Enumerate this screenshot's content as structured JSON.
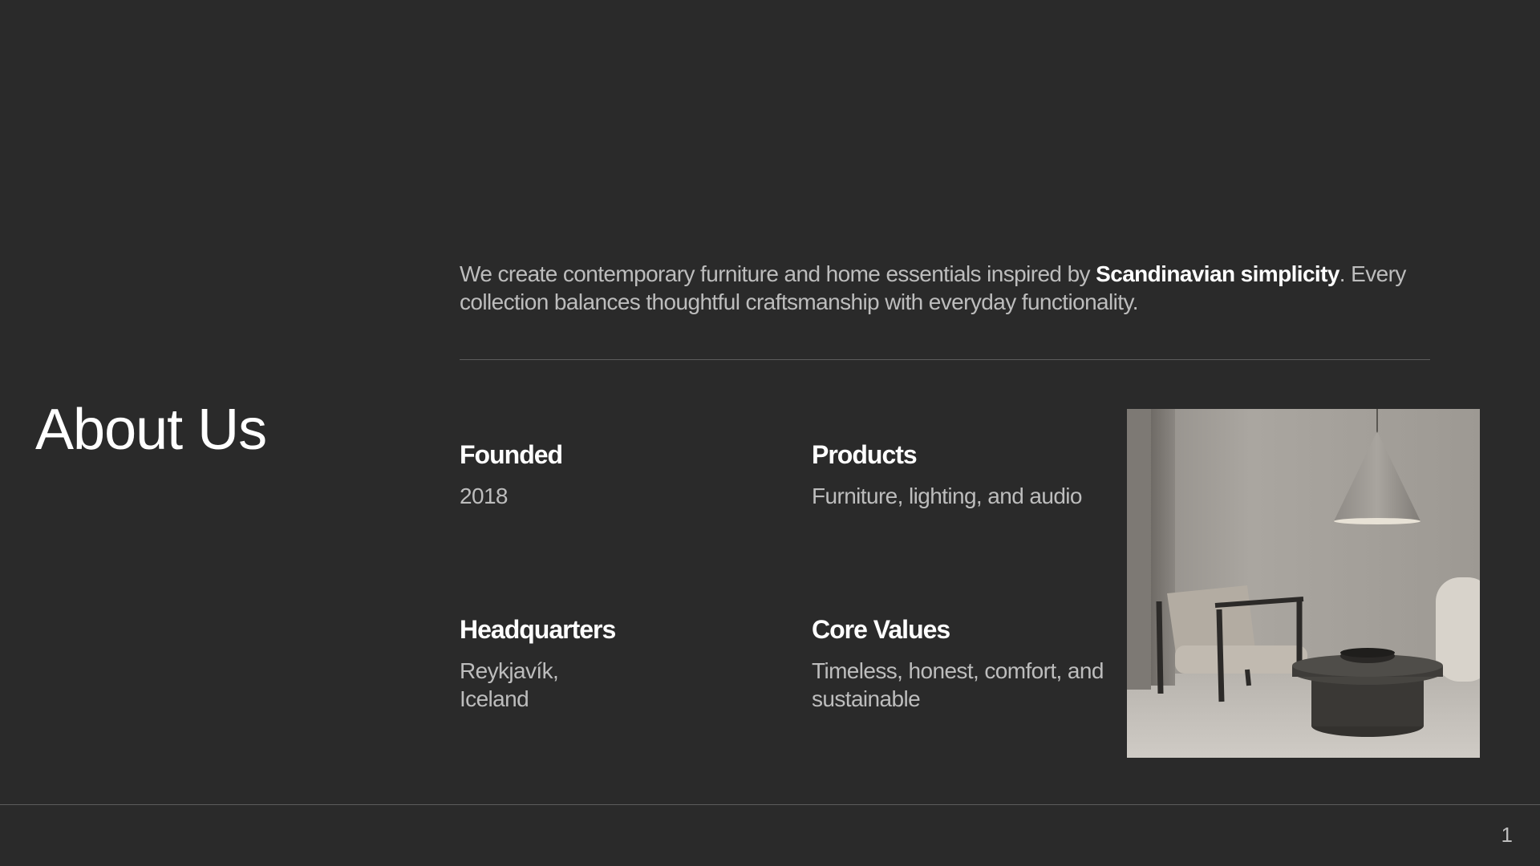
{
  "slide": {
    "title": "About Us",
    "intro": {
      "before": "We create contemporary furniture and home essentials inspired by ",
      "emphasis": "Scandinavian simplicity",
      "after": ". Every collection balances thoughtful craftsmanship with everyday functionality."
    },
    "facts": {
      "founded": {
        "label": "Founded",
        "value": "2018"
      },
      "products": {
        "label": "Products",
        "value": "Furniture, lighting, and audio"
      },
      "headquarters": {
        "label": "Headquarters",
        "value": "Reykjavík, Iceland"
      },
      "core_values": {
        "label": "Core Values",
        "value": "Timeless, honest, comfort, and sustainable"
      }
    },
    "image": {
      "icon": "interior-photo-icon"
    },
    "page_number": "1"
  },
  "colors": {
    "background": "#2a2a2a",
    "heading": "#ffffff",
    "body_text": "#bdbdbd",
    "divider": "#5c5c5c"
  }
}
